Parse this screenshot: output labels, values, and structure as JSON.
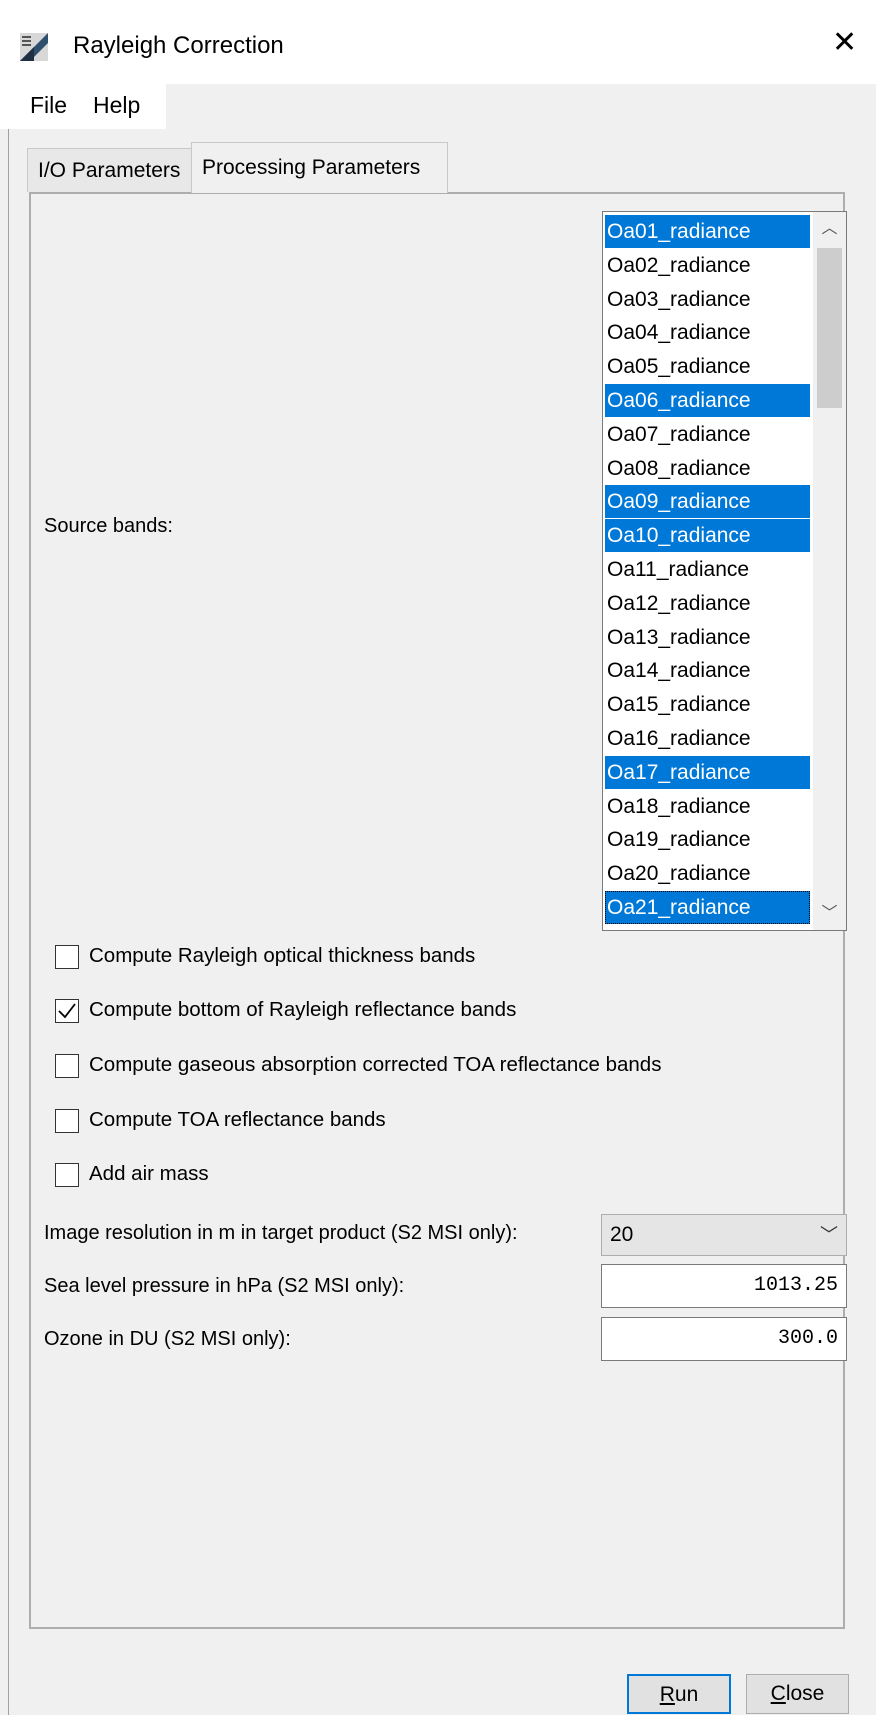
{
  "window": {
    "title": "Rayleigh Correction",
    "app_icon": "snap-logo-icon",
    "close_glyph": "✕"
  },
  "menu": {
    "file": "File",
    "help": "Help"
  },
  "tabs": [
    {
      "label": "I/O Parameters"
    },
    {
      "label": "Processing Parameters"
    }
  ],
  "source_bands": {
    "label": "Source bands:",
    "items": [
      {
        "label": "Oa01_radiance",
        "selected": true
      },
      {
        "label": "Oa02_radiance",
        "selected": false
      },
      {
        "label": "Oa03_radiance",
        "selected": false
      },
      {
        "label": "Oa04_radiance",
        "selected": false
      },
      {
        "label": "Oa05_radiance",
        "selected": false
      },
      {
        "label": "Oa06_radiance",
        "selected": true
      },
      {
        "label": "Oa07_radiance",
        "selected": false
      },
      {
        "label": "Oa08_radiance",
        "selected": false
      },
      {
        "label": "Oa09_radiance",
        "selected": true
      },
      {
        "label": "Oa10_radiance",
        "selected": true
      },
      {
        "label": "Oa11_radiance",
        "selected": false
      },
      {
        "label": "Oa12_radiance",
        "selected": false
      },
      {
        "label": "Oa13_radiance",
        "selected": false
      },
      {
        "label": "Oa14_radiance",
        "selected": false
      },
      {
        "label": "Oa15_radiance",
        "selected": false
      },
      {
        "label": "Oa16_radiance",
        "selected": false
      },
      {
        "label": "Oa17_radiance",
        "selected": true
      },
      {
        "label": "Oa18_radiance",
        "selected": false
      },
      {
        "label": "Oa19_radiance",
        "selected": false
      },
      {
        "label": "Oa20_radiance",
        "selected": false
      },
      {
        "label": "Oa21_radiance",
        "selected": true,
        "focused": true
      }
    ]
  },
  "options": [
    {
      "label": "Compute Rayleigh optical thickness bands",
      "checked": false
    },
    {
      "label": "Compute bottom of Rayleigh reflectance bands",
      "checked": true
    },
    {
      "label": "Compute gaseous absorption corrected TOA reflectance bands",
      "checked": false
    },
    {
      "label": "Compute TOA reflectance bands",
      "checked": false
    },
    {
      "label": "Add air mass",
      "checked": false
    }
  ],
  "image_resolution": {
    "label": "Image resolution in m in target product (S2 MSI only):",
    "value": "20"
  },
  "sea_level_pressure": {
    "label": "Sea level pressure in hPa (S2 MSI only):",
    "value": "1013.25"
  },
  "ozone": {
    "label": "Ozone in DU (S2 MSI only):",
    "value": "300.0"
  },
  "buttons": {
    "run": {
      "mnemonic": "R",
      "rest": "un"
    },
    "close": {
      "mnemonic": "C",
      "rest": "lose"
    }
  },
  "colors": {
    "selection": "#0078d7",
    "panel_bg": "#f0f0f0"
  }
}
